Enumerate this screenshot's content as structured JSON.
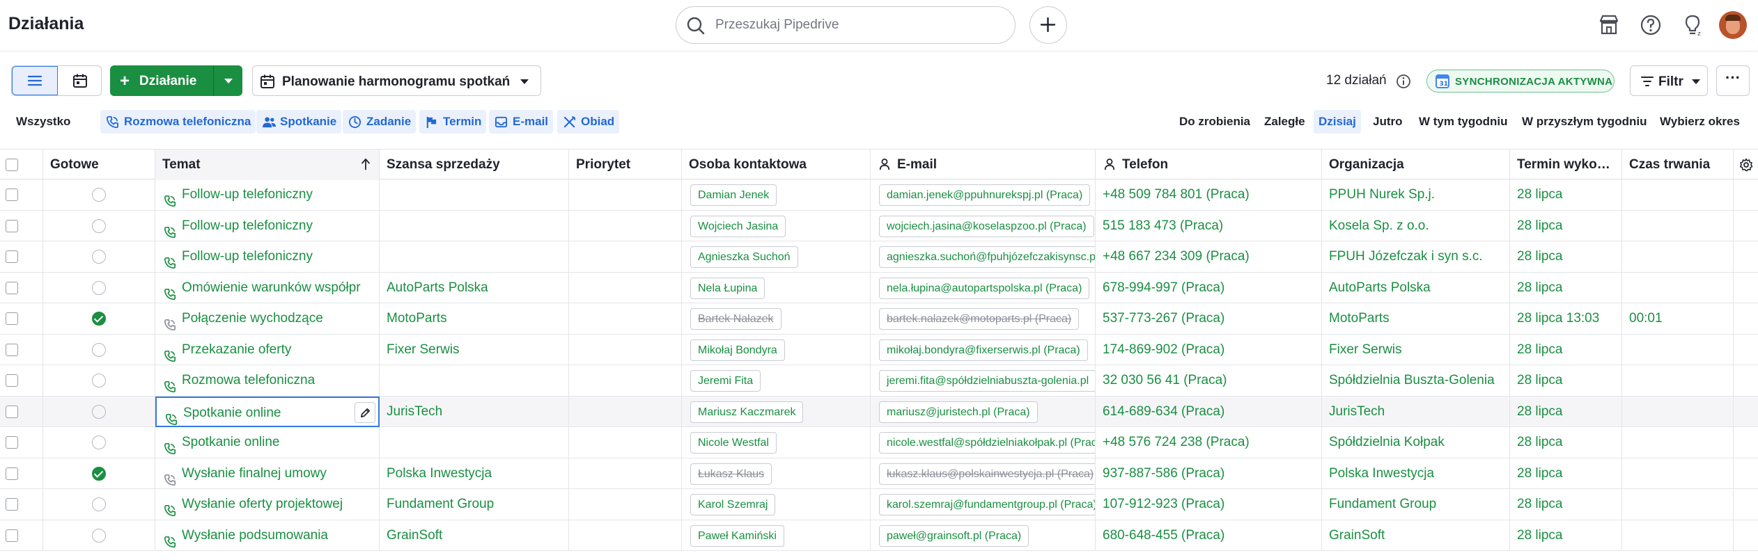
{
  "header": {
    "title": "Działania",
    "search_placeholder": "Przeszukaj Pipedrive"
  },
  "toolbar": {
    "add_label": "Działanie",
    "filter_label": "Planowanie harmonogramu spotkań",
    "count_text": "12 działań",
    "sync_label": "SYNCHRONIZACJA AKTYWNA",
    "filter_button": "Filtr",
    "more_label": "···"
  },
  "type_filters": {
    "all": "Wszystko",
    "call": "Rozmowa telefoniczna",
    "meeting": "Spotkanie",
    "task": "Zadanie",
    "deadline": "Termin",
    "email": "E-mail",
    "lunch": "Obiad"
  },
  "time_filters": {
    "todo": "Do zrobienia",
    "overdue": "Zaległe",
    "today": "Dzisiaj",
    "tomorrow": "Jutro",
    "this_week": "W tym tygodniu",
    "next_week": "W przyszłym tygodniu",
    "choose_period": "Wybierz okres"
  },
  "columns": {
    "done": "Gotowe",
    "subject": "Temat",
    "deal": "Szansa sprzedaży",
    "priority": "Priorytet",
    "contact": "Osoba kontaktowa",
    "email": "E-mail",
    "phone": "Telefon",
    "org": "Organizacja",
    "due": "Termin wyko…",
    "duration": "Czas trwania"
  },
  "rows": [
    {
      "done": false,
      "subject": "Follow-up telefoniczny",
      "deal": "",
      "contact": "Damian Jenek",
      "email": "damian.jenek@ppuhnurekspj.pl (Praca)",
      "phone": "+48 509 784 801 (Praca)",
      "org": "PPUH Nurek Sp.j.",
      "due": "28 lipca",
      "duration": ""
    },
    {
      "done": false,
      "subject": "Follow-up telefoniczny",
      "deal": "",
      "contact": "Wojciech Jasina",
      "email": "wojciech.jasina@koselaspzoo.pl (Praca)",
      "phone": "515 183 473 (Praca)",
      "org": "Kosela Sp. z o.o.",
      "due": "28 lipca",
      "duration": ""
    },
    {
      "done": false,
      "subject": "Follow-up telefoniczny",
      "deal": "",
      "contact": "Agnieszka Suchoń",
      "email": "agnieszka.suchoń@fpuhjózefczakisynsc.pl",
      "phone": "+48 667 234 309 (Praca)",
      "org": "FPUH Józefczak i syn s.c.",
      "due": "28 lipca",
      "duration": ""
    },
    {
      "done": false,
      "subject": "Omówienie warunków współpr",
      "deal": "AutoParts Polska",
      "contact": "Nela Łupina",
      "email": "nela.łupina@autopartspolska.pl (Praca)",
      "phone": "678-994-997 (Praca)",
      "org": "AutoParts Polska",
      "due": "28 lipca",
      "duration": ""
    },
    {
      "done": true,
      "subject": "Połączenie wychodzące",
      "deal": "MotoParts",
      "contact": "Bartek Nalazek",
      "email": "bartek.nalazek@motoparts.pl (Praca)",
      "phone": "537-773-267 (Praca)",
      "org": "MotoParts",
      "due": "28 lipca 13:03",
      "duration": "00:01"
    },
    {
      "done": false,
      "subject": "Przekazanie oferty",
      "deal": "Fixer Serwis",
      "contact": "Mikołaj Bondyra",
      "email": "mikołaj.bondyra@fixerserwis.pl (Praca)",
      "phone": "174-869-902 (Praca)",
      "org": "Fixer Serwis",
      "due": "28 lipca",
      "duration": ""
    },
    {
      "done": false,
      "subject": "Rozmowa telefoniczna",
      "deal": "",
      "contact": "Jeremi Fita",
      "email": "jeremi.fita@spółdzielniabuszta-golenia.pl",
      "phone": "32 030 56 41 (Praca)",
      "org": "Spółdzielnia Buszta-Goleniа",
      "due": "28 lipca",
      "duration": ""
    },
    {
      "done": false,
      "subject": "Spotkanie online",
      "deal": "JurisTech",
      "contact": "Mariusz Kaczmarek",
      "email": "mariusz@juristech.pl (Praca)",
      "phone": "614-689-634 (Praca)",
      "org": "JurisTech",
      "due": "28 lipca",
      "duration": ""
    },
    {
      "done": false,
      "subject": "Spotkanie online",
      "deal": "",
      "contact": "Nicole Westfal",
      "email": "nicole.westfal@spółdzielniakołpak.pl (Praca)",
      "phone": "+48 576 724 238 (Praca)",
      "org": "Spółdzielnia Kołpak",
      "due": "28 lipca",
      "duration": ""
    },
    {
      "done": true,
      "subject": "Wysłanie finalnej umowy",
      "deal": "Polska Inwestycja",
      "contact": "Łukasz Klaus",
      "email": "łukasz.klaus@polskainwestycja.pl (Praca)",
      "phone": "937-887-586 (Praca)",
      "org": "Polska Inwestycja",
      "due": "28 lipca",
      "duration": ""
    },
    {
      "done": false,
      "subject": "Wysłanie oferty projektowej",
      "deal": "Fundament Group",
      "contact": "Karol Szemraj",
      "email": "karol.szemraj@fundamentgroup.pl (Praca)",
      "phone": "107-912-923 (Praca)",
      "org": "Fundament Group",
      "due": "28 lipca",
      "duration": ""
    },
    {
      "done": false,
      "subject": "Wysłanie podsumowania",
      "deal": "GrainSoft",
      "contact": "Paweł Kamiński",
      "email": "paweł@grainsoft.pl (Praca)",
      "phone": "680-648-455 (Praca)",
      "org": "GrainSoft",
      "due": "28 lipca",
      "duration": ""
    }
  ],
  "colors": {
    "brand_green": "#1a8f42",
    "link_blue": "#2468d2",
    "accent_blue": "#317ae2"
  }
}
